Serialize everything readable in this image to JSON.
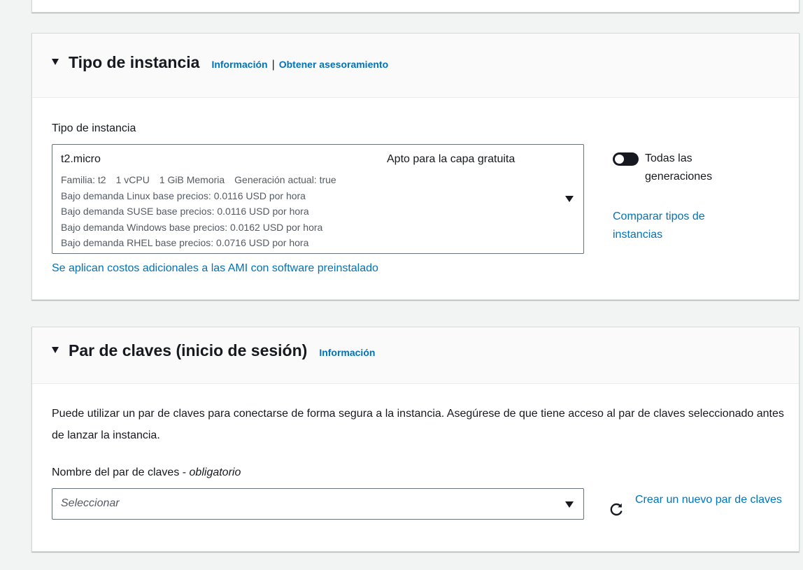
{
  "instance_type_section": {
    "title": "Tipo de instancia",
    "info_link": "Información",
    "separator": "|",
    "advice_link": "Obtener asesoramiento",
    "field_label": "Tipo de instancia",
    "selected": {
      "name": "t2.micro",
      "tag": "Apto para la capa gratuita",
      "family": "Familia: t2",
      "vcpu": "1 vCPU",
      "memory": "1 GiB Memoria",
      "generation": "Generación actual: true",
      "pricing": [
        "Bajo demanda Linux base precios: 0.0116 USD por hora",
        "Bajo demanda SUSE base precios: 0.0116 USD por hora",
        "Bajo demanda Windows base precios: 0.0162 USD por hora",
        "Bajo demanda RHEL base precios: 0.0716 USD por hora"
      ]
    },
    "all_generations_toggle": {
      "label": "Todas las generaciones",
      "on": true
    },
    "compare_link": "Comparar tipos de instancias",
    "ami_cost_link": "Se aplican costos adicionales a las AMI con software preinstalado"
  },
  "keypair_section": {
    "title": "Par de claves (inicio de sesión)",
    "info_link": "Información",
    "description": "Puede utilizar un par de claves para conectarse de forma segura a la instancia. Asegúrese de que tiene acceso al par de claves seleccionado antes de lanzar la instancia.",
    "field_label": "Nombre del par de claves - ",
    "field_label_required": "obligatorio",
    "placeholder": "Seleccionar",
    "create_link": "Crear un nuevo par de claves"
  },
  "colors": {
    "link": "#0073bb",
    "text": "#16191f",
    "secondary_text": "#545b64",
    "border": "#687078",
    "background": "#f2f3f3"
  },
  "icons": [
    "caret-down-icon",
    "refresh-icon",
    "toggle-icon"
  ]
}
